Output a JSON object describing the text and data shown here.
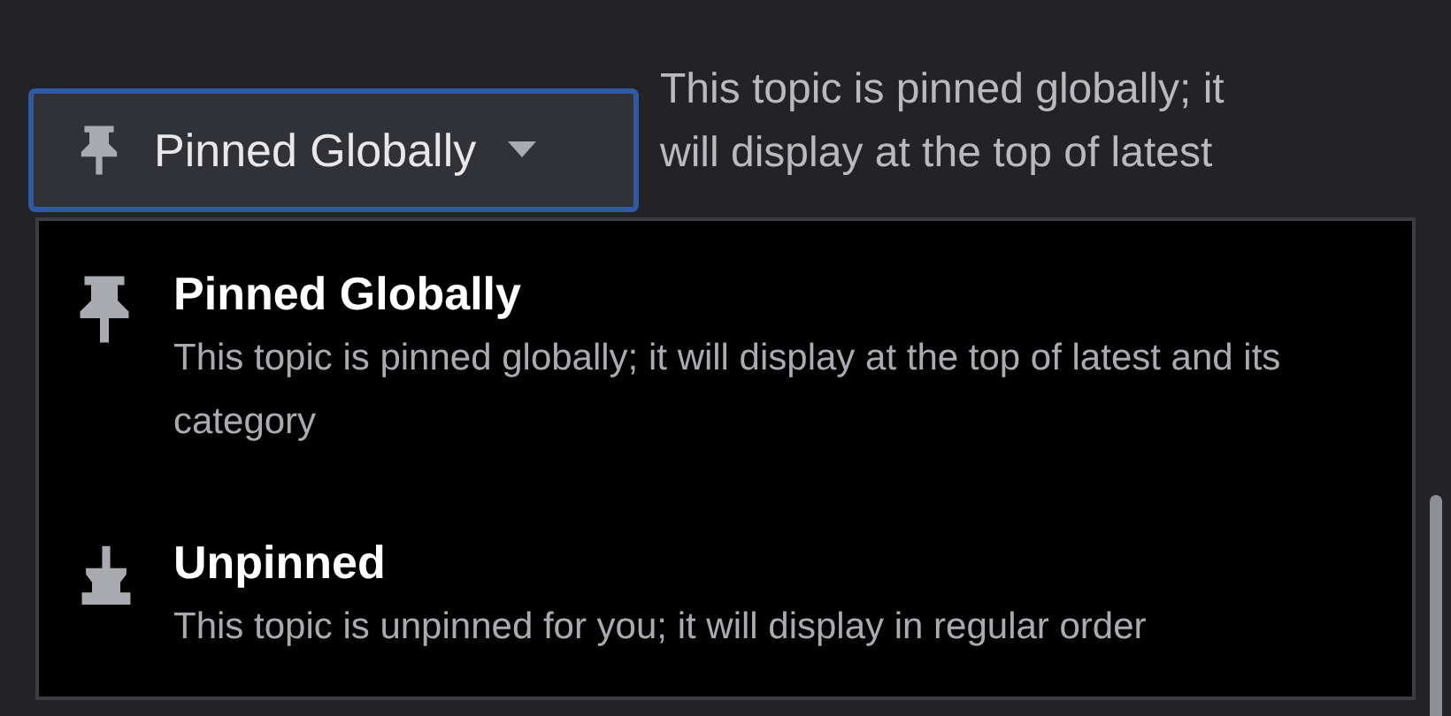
{
  "dropdown": {
    "label": "Pinned Globally",
    "expanded": true
  },
  "description": "This topic is pinned globally; it will display at the top of latest",
  "options": [
    {
      "kind": "pinned",
      "title": "Pinned Globally",
      "description": "This topic is pinned globally; it will display at the top of latest and its category"
    },
    {
      "kind": "unpinned",
      "title": "Unpinned",
      "description": "This topic is unpinned for you; it will display in regular order"
    }
  ]
}
